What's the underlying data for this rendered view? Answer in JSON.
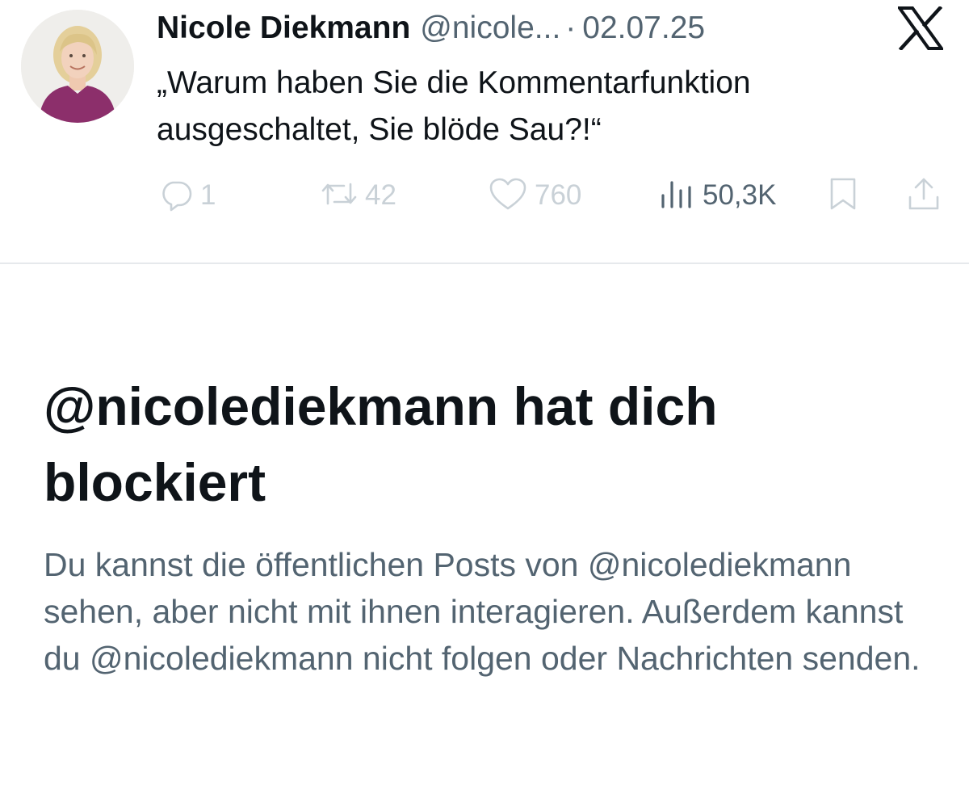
{
  "tweet": {
    "author_name": "Nicole Diekmann",
    "author_handle": "@nicole...",
    "separator": "·",
    "date": "02.07.25",
    "text": "„Warum haben Sie die Kommentarfunktion ausgeschaltet, Sie blöde Sau?!“",
    "platform_icon": "x-logo-icon",
    "actions": {
      "replies": {
        "icon": "reply-icon",
        "count": "1"
      },
      "reposts": {
        "icon": "repost-icon",
        "count": "42"
      },
      "likes": {
        "icon": "heart-icon",
        "count": "760"
      },
      "views": {
        "icon": "views-icon",
        "count": "50,3K"
      },
      "bookmark": {
        "icon": "bookmark-icon"
      },
      "share": {
        "icon": "share-icon"
      }
    }
  },
  "blocked_notice": {
    "title": "@nicolediekmann hat dich blockiert",
    "body": "Du kannst die öffentlichen Posts von @nicolediekmann sehen, aber nicht mit ihnen interagieren. Außerdem kannst du @nicolediekmann nicht folgen oder Nachrichten senden."
  },
  "colors": {
    "text_primary": "#0f1419",
    "text_secondary": "#536471",
    "icon_faint": "#c9d1d7",
    "divider": "#e6e9ec",
    "avatar_blouse": "#8c2f6b"
  }
}
